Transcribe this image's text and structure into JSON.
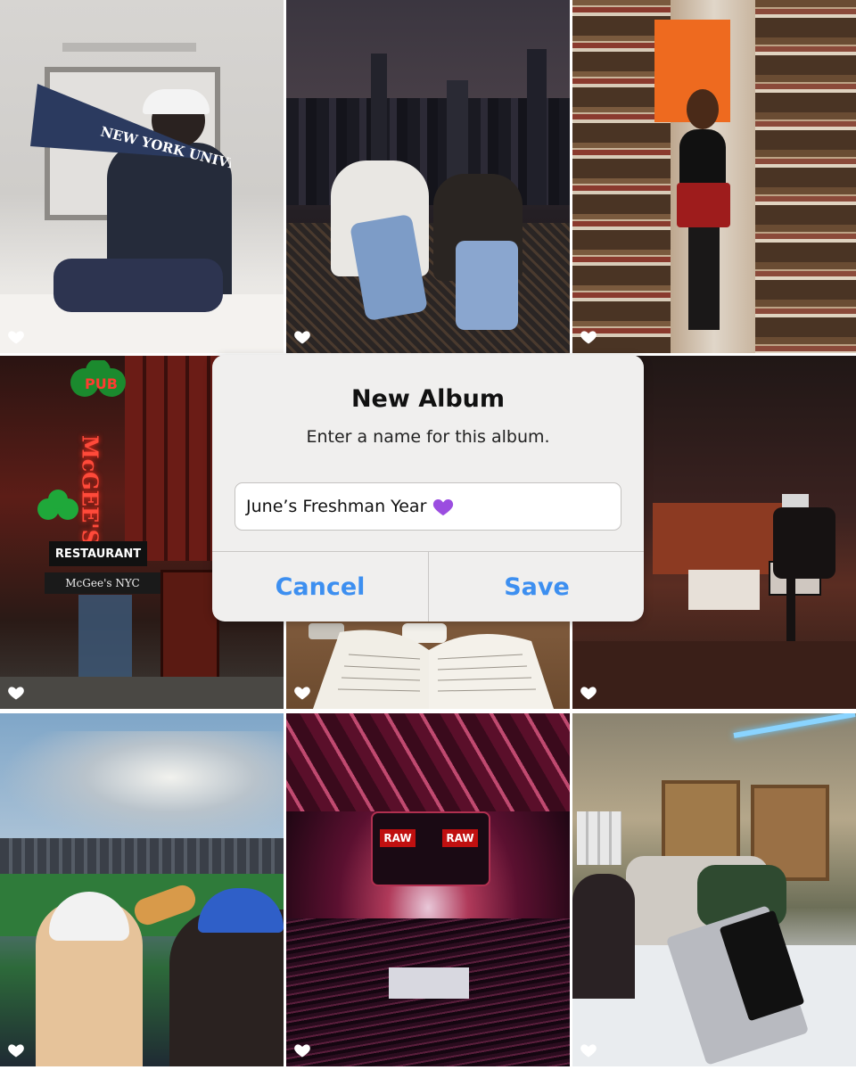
{
  "dialog": {
    "title": "New Album",
    "message": "Enter a name for this album.",
    "input_value": "June’s Freshman Year",
    "input_emoji": "purple-heart-icon",
    "cancel_label": "Cancel",
    "save_label": "Save"
  },
  "photos": {
    "pennant_text": "NEW YORK UNIVERSITY",
    "pub_sign": "PUB",
    "mcgees_sign": "McGEE'S",
    "restaurant_sign": "RESTAURANT",
    "awning_text": "McGee's NYC",
    "raw_sign": "RAW"
  },
  "colors": {
    "accent": "#3d8ff0",
    "dialog_bg": "#f0efee",
    "heart": "#ffffff",
    "emoji_heart": "#9b4de0"
  }
}
